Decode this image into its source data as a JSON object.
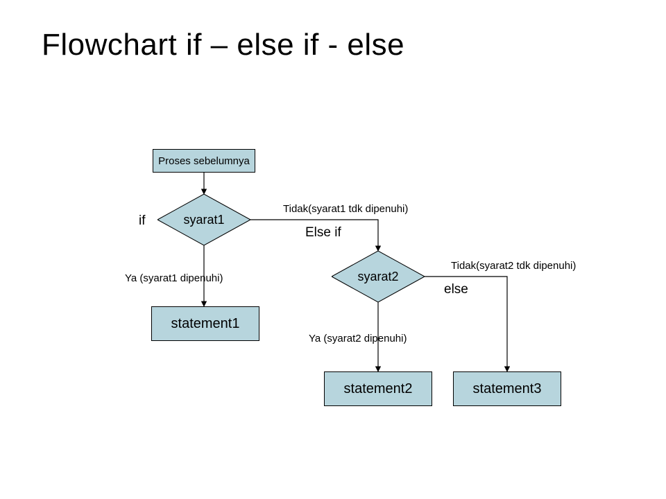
{
  "title": "Flowchart if – else if - else",
  "nodes": {
    "prev": "Proses sebelumnya",
    "cond1": "syarat1",
    "cond2": "syarat2",
    "stmt1": "statement1",
    "stmt2": "statement2",
    "stmt3": "statement3"
  },
  "labels": {
    "if": "if",
    "elseif": "Else if",
    "else": "else",
    "yes1": "Ya (syarat1 dipenuhi)",
    "no1": "Tidak(syarat1 tdk dipenuhi)",
    "yes2": "Ya (syarat2 dipenuhi)",
    "no2": "Tidak(syarat2 tdk dipenuhi)"
  },
  "colors": {
    "fill": "#b7d5dd",
    "stroke": "#000000"
  }
}
